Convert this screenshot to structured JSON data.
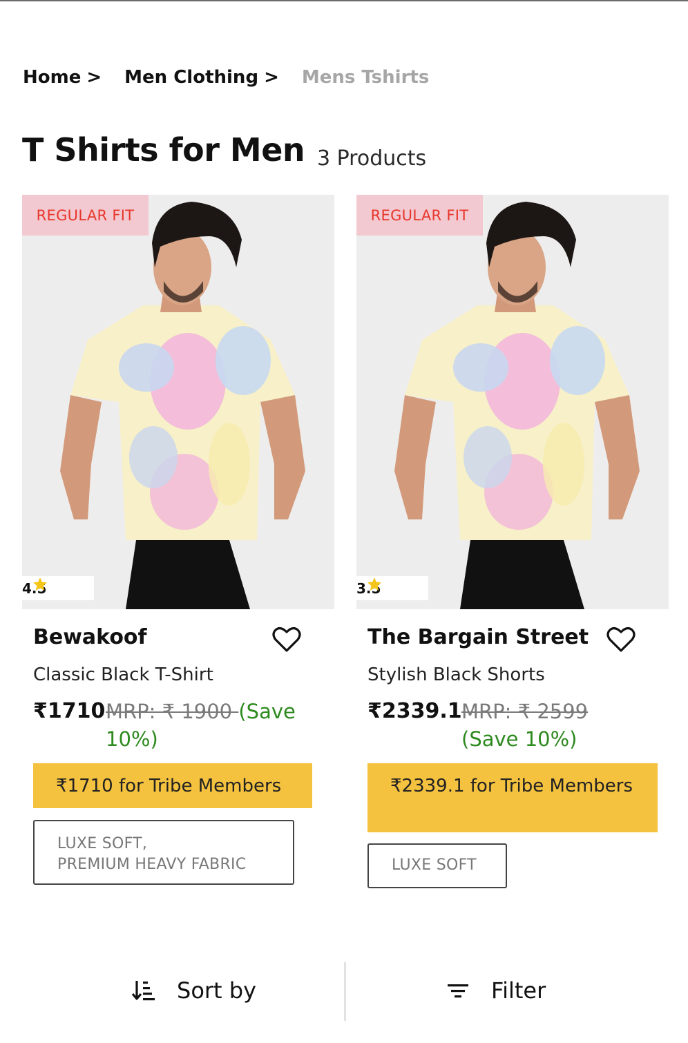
{
  "breadcrumb": {
    "items": [
      "Home",
      "Men Clothing"
    ],
    "separator": ">",
    "current": "Mens Tshirts"
  },
  "page": {
    "title": "T Shirts for Men",
    "count": "3 Products"
  },
  "products": [
    {
      "fit_badge": "REGULAR FIT",
      "rating": "4.5",
      "brand": "Bewakoof",
      "name": "Classic Black T-Shirt",
      "price": "₹1710",
      "mrp": "MRP: ₹ 1900 ",
      "save": "(Save 10%)",
      "tribe": "₹1710 for Tribe Members",
      "tag_line1": "LUXE SOFT,",
      "tag_line2": "PREMIUM HEAVY FABRIC"
    },
    {
      "fit_badge": "REGULAR FIT",
      "rating": "3.5",
      "brand": "The Bargain Street",
      "name": "Stylish Black Shorts",
      "price": "₹2339.1",
      "mrp": "MRP: ₹ 2599",
      "save": "(Save 10%)",
      "tribe": "₹2339.1 for Tribe Members",
      "tag_line1": "LUXE SOFT"
    }
  ],
  "toolbar": {
    "sort_label": "Sort by",
    "filter_label": "Filter"
  },
  "colors": {
    "tribe_bg": "#f4c23f",
    "badge_bg": "#f2c9d0",
    "badge_text": "#e8352a",
    "save_text": "#2d8a1e"
  },
  "icons": [
    "star-icon",
    "heart-icon",
    "sort-icon",
    "filter-icon"
  ]
}
